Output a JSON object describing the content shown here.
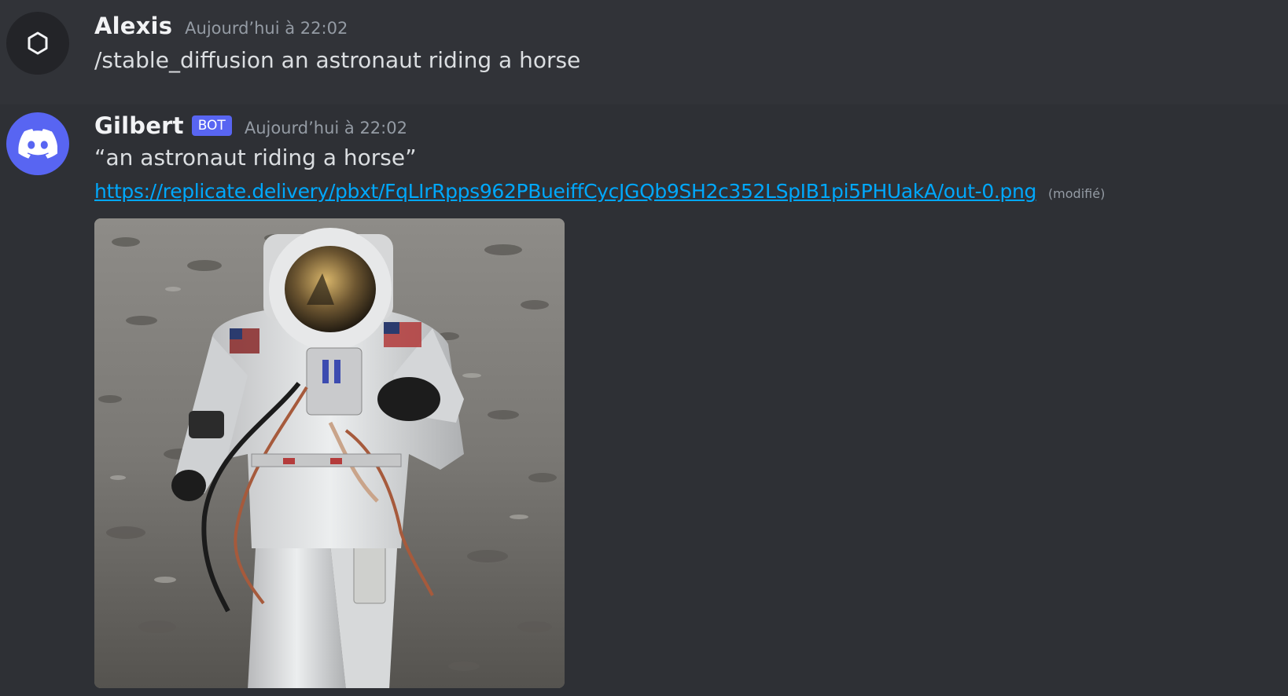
{
  "messages": [
    {
      "author": "Alexis",
      "timestamp": "Aujourd’hui à 22:02",
      "avatar_icon": "hexagon-outline-icon",
      "text": "/stable_diffusion  an astronaut riding a horse"
    },
    {
      "author": "Gilbert",
      "badge": "BOT",
      "timestamp": "Aujourd’hui à 22:02",
      "avatar_icon": "discord-logo-icon",
      "avatar_color": "#5865f2",
      "quote": "“an astronaut riding a horse”",
      "link": "https://replicate.delivery/pbxt/FqLIrRpps962PBueiffCycJGQb9SH2c352LSpIB1pi5PHUakA/out-0.png",
      "edited": "(modifié)",
      "attachment": "generated-image-astronaut-on-moon"
    }
  ],
  "colors": {
    "background": "#313338",
    "link": "#00a8fc",
    "bot_badge": "#5865f2"
  }
}
